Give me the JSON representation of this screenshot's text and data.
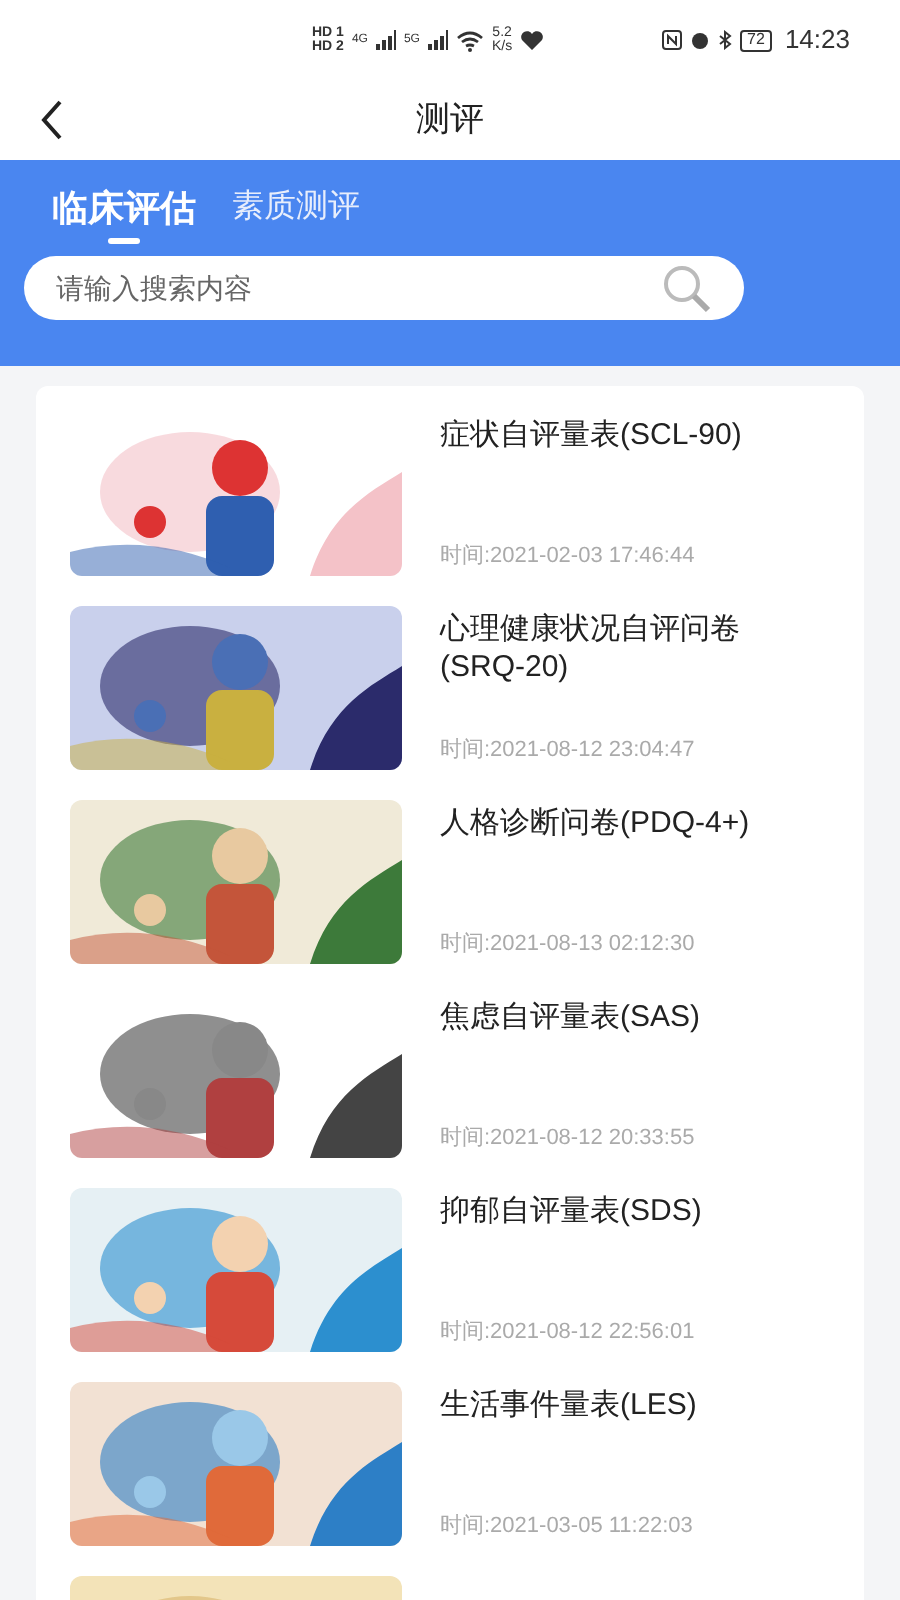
{
  "status_bar": {
    "sim_1": "HD 1",
    "sim_2": "HD 2",
    "network_1": "4G",
    "network_2": "5G",
    "speed": "5.2",
    "speed_unit": "K/s",
    "battery": "72",
    "time": "14:23"
  },
  "header": {
    "title": "测评"
  },
  "tabs": [
    {
      "label": "临床评估",
      "selected": true
    },
    {
      "label": "素质测评",
      "selected": false
    }
  ],
  "search": {
    "placeholder": "请输入搜索内容"
  },
  "items": [
    {
      "title": "症状自评量表(SCL-90)",
      "time": "时间:2021-02-03 17:46:44",
      "image": {
        "kind": "picture"
      }
    },
    {
      "title": "心理健康状况自评问卷(SRQ-20)",
      "time": "时间:2021-08-12 23:04:47",
      "image": {
        "kind": "picture"
      }
    },
    {
      "title": "人格诊断问卷(PDQ-4+)",
      "time": "时间:2021-08-13 02:12:30",
      "image": {
        "kind": "picture"
      }
    },
    {
      "title": "焦虑自评量表(SAS)",
      "time": "时间:2021-08-12 20:33:55",
      "image": {
        "kind": "picture"
      }
    },
    {
      "title": "抑郁自评量表(SDS)",
      "time": "时间:2021-08-12 22:56:01",
      "image": {
        "kind": "picture"
      }
    },
    {
      "title": "生活事件量表(LES)",
      "time": "时间:2021-03-05 11:22:03",
      "image": {
        "kind": "picture"
      }
    },
    {
      "image": {
        "kind": "picture"
      }
    }
  ]
}
